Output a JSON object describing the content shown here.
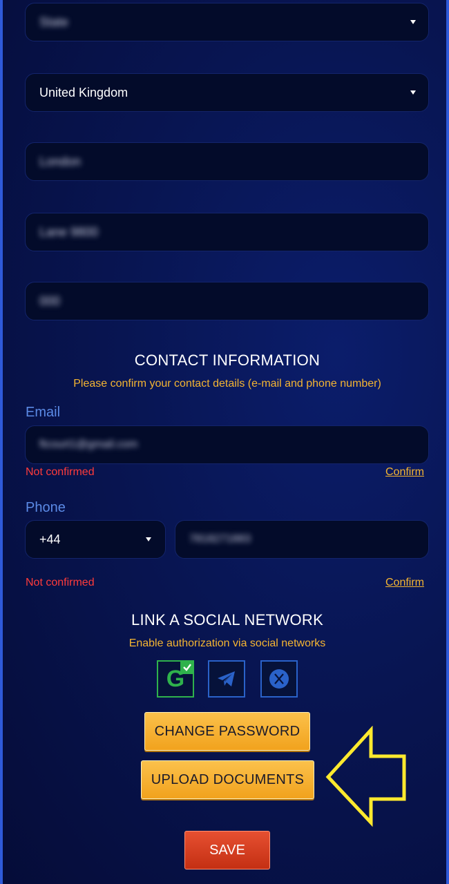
{
  "profile": {
    "state_value": "State",
    "country_value": "United Kingdom",
    "city_value": "London",
    "address_value": "Lane 9800",
    "zip_value": "000"
  },
  "contact": {
    "title": "CONTACT INFORMATION",
    "subtitle": "Please confirm your contact details (e-mail and phone number)",
    "email_label": "Email",
    "email_value": "ftcourt1@gmail.com",
    "email_status": "Not confirmed",
    "email_confirm": "Confirm",
    "phone_label": "Phone",
    "phone_code": "+44",
    "phone_value": "7818271883",
    "phone_status": "Not confirmed",
    "phone_confirm": "Confirm"
  },
  "social": {
    "title": "LINK A SOCIAL NETWORK",
    "subtitle": "Enable authorization via social networks",
    "google_letter": "G",
    "colors": {
      "google": "#2fb24c",
      "telegram": "#2a62c9",
      "x": "#2a62c9"
    }
  },
  "actions": {
    "change_password": "CHANGE PASSWORD",
    "upload_documents": "UPLOAD DOCUMENTS",
    "save": "SAVE"
  },
  "colors": {
    "accent": "#f5b532",
    "error": "#ff3b3b",
    "label": "#5b8ae6",
    "arrow": "#ffe92e"
  }
}
